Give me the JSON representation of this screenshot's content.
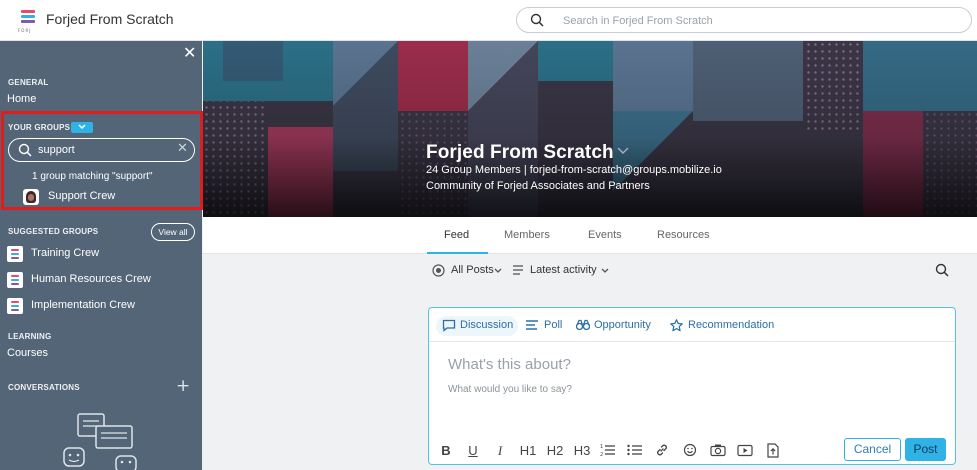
{
  "app": {
    "title": "Forjed From Scratch",
    "logo_tag": "FORJ",
    "search_placeholder": "Search in Forjed From Scratch"
  },
  "sidebar": {
    "general_label": "GENERAL",
    "home_label": "Home",
    "your_groups_label": "YOUR GROUPS",
    "group_search_value": "support",
    "match_text": "1 group matching \"support\"",
    "matched_group": "Support Crew",
    "suggested_label": "SUGGESTED GROUPS",
    "view_all_label": "View all",
    "suggested_groups": [
      "Training Crew",
      "Human Resources Crew",
      "Implementation Crew"
    ],
    "learning_label": "LEARNING",
    "courses_label": "Courses",
    "conversations_label": "CONVERSATIONS"
  },
  "group": {
    "name": "Forjed From Scratch",
    "meta": "24 Group Members | forjed-from-scratch@groups.mobilize.io",
    "description": "Community of Forjed Associates and Partners"
  },
  "tabs": [
    "Feed",
    "Members",
    "Events",
    "Resources"
  ],
  "active_tab": "Feed",
  "feed": {
    "filter_posts": "All Posts",
    "filter_sort": "Latest activity"
  },
  "composer": {
    "types": [
      "Discussion",
      "Poll",
      "Opportunity",
      "Recommendation"
    ],
    "active_type": "Discussion",
    "subject_placeholder": "What's this about?",
    "body_placeholder": "What would you like to say?",
    "toolbar": [
      "B",
      "U",
      "I",
      "H1",
      "H2",
      "H3"
    ],
    "cancel_label": "Cancel",
    "post_label": "Post"
  },
  "colors": {
    "sidebar_bg": "#546577",
    "accent": "#2fb3e6",
    "highlight": "#e21b1b",
    "link": "#2a6fa8"
  },
  "icons": [
    "search-icon",
    "close-icon",
    "chevron-down-icon",
    "plus-icon",
    "discussion-icon",
    "poll-icon",
    "opportunity-icon",
    "recommendation-icon",
    "link-icon",
    "camera-icon",
    "video-icon",
    "attach-icon",
    "emoji-icon"
  ]
}
